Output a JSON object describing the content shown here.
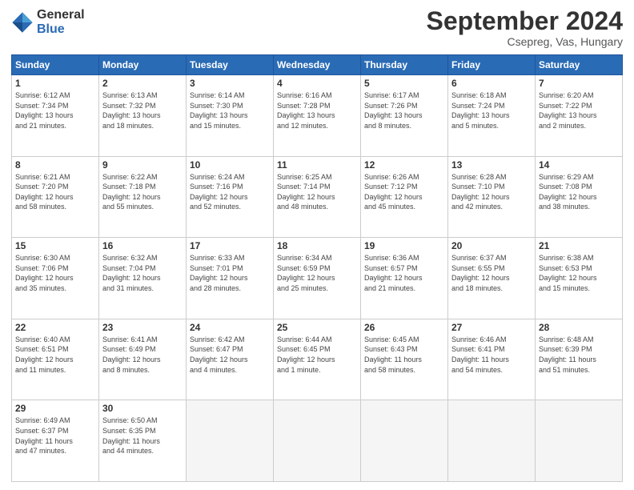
{
  "header": {
    "logo": {
      "general": "General",
      "blue": "Blue"
    },
    "title": "September 2024",
    "subtitle": "Csepreg, Vas, Hungary"
  },
  "weekdays": [
    "Sunday",
    "Monday",
    "Tuesday",
    "Wednesday",
    "Thursday",
    "Friday",
    "Saturday"
  ],
  "weeks": [
    [
      {
        "day": "1",
        "info": "Sunrise: 6:12 AM\nSunset: 7:34 PM\nDaylight: 13 hours\nand 21 minutes."
      },
      {
        "day": "2",
        "info": "Sunrise: 6:13 AM\nSunset: 7:32 PM\nDaylight: 13 hours\nand 18 minutes."
      },
      {
        "day": "3",
        "info": "Sunrise: 6:14 AM\nSunset: 7:30 PM\nDaylight: 13 hours\nand 15 minutes."
      },
      {
        "day": "4",
        "info": "Sunrise: 6:16 AM\nSunset: 7:28 PM\nDaylight: 13 hours\nand 12 minutes."
      },
      {
        "day": "5",
        "info": "Sunrise: 6:17 AM\nSunset: 7:26 PM\nDaylight: 13 hours\nand 8 minutes."
      },
      {
        "day": "6",
        "info": "Sunrise: 6:18 AM\nSunset: 7:24 PM\nDaylight: 13 hours\nand 5 minutes."
      },
      {
        "day": "7",
        "info": "Sunrise: 6:20 AM\nSunset: 7:22 PM\nDaylight: 13 hours\nand 2 minutes."
      }
    ],
    [
      {
        "day": "8",
        "info": "Sunrise: 6:21 AM\nSunset: 7:20 PM\nDaylight: 12 hours\nand 58 minutes."
      },
      {
        "day": "9",
        "info": "Sunrise: 6:22 AM\nSunset: 7:18 PM\nDaylight: 12 hours\nand 55 minutes."
      },
      {
        "day": "10",
        "info": "Sunrise: 6:24 AM\nSunset: 7:16 PM\nDaylight: 12 hours\nand 52 minutes."
      },
      {
        "day": "11",
        "info": "Sunrise: 6:25 AM\nSunset: 7:14 PM\nDaylight: 12 hours\nand 48 minutes."
      },
      {
        "day": "12",
        "info": "Sunrise: 6:26 AM\nSunset: 7:12 PM\nDaylight: 12 hours\nand 45 minutes."
      },
      {
        "day": "13",
        "info": "Sunrise: 6:28 AM\nSunset: 7:10 PM\nDaylight: 12 hours\nand 42 minutes."
      },
      {
        "day": "14",
        "info": "Sunrise: 6:29 AM\nSunset: 7:08 PM\nDaylight: 12 hours\nand 38 minutes."
      }
    ],
    [
      {
        "day": "15",
        "info": "Sunrise: 6:30 AM\nSunset: 7:06 PM\nDaylight: 12 hours\nand 35 minutes."
      },
      {
        "day": "16",
        "info": "Sunrise: 6:32 AM\nSunset: 7:04 PM\nDaylight: 12 hours\nand 31 minutes."
      },
      {
        "day": "17",
        "info": "Sunrise: 6:33 AM\nSunset: 7:01 PM\nDaylight: 12 hours\nand 28 minutes."
      },
      {
        "day": "18",
        "info": "Sunrise: 6:34 AM\nSunset: 6:59 PM\nDaylight: 12 hours\nand 25 minutes."
      },
      {
        "day": "19",
        "info": "Sunrise: 6:36 AM\nSunset: 6:57 PM\nDaylight: 12 hours\nand 21 minutes."
      },
      {
        "day": "20",
        "info": "Sunrise: 6:37 AM\nSunset: 6:55 PM\nDaylight: 12 hours\nand 18 minutes."
      },
      {
        "day": "21",
        "info": "Sunrise: 6:38 AM\nSunset: 6:53 PM\nDaylight: 12 hours\nand 15 minutes."
      }
    ],
    [
      {
        "day": "22",
        "info": "Sunrise: 6:40 AM\nSunset: 6:51 PM\nDaylight: 12 hours\nand 11 minutes."
      },
      {
        "day": "23",
        "info": "Sunrise: 6:41 AM\nSunset: 6:49 PM\nDaylight: 12 hours\nand 8 minutes."
      },
      {
        "day": "24",
        "info": "Sunrise: 6:42 AM\nSunset: 6:47 PM\nDaylight: 12 hours\nand 4 minutes."
      },
      {
        "day": "25",
        "info": "Sunrise: 6:44 AM\nSunset: 6:45 PM\nDaylight: 12 hours\nand 1 minute."
      },
      {
        "day": "26",
        "info": "Sunrise: 6:45 AM\nSunset: 6:43 PM\nDaylight: 11 hours\nand 58 minutes."
      },
      {
        "day": "27",
        "info": "Sunrise: 6:46 AM\nSunset: 6:41 PM\nDaylight: 11 hours\nand 54 minutes."
      },
      {
        "day": "28",
        "info": "Sunrise: 6:48 AM\nSunset: 6:39 PM\nDaylight: 11 hours\nand 51 minutes."
      }
    ],
    [
      {
        "day": "29",
        "info": "Sunrise: 6:49 AM\nSunset: 6:37 PM\nDaylight: 11 hours\nand 47 minutes."
      },
      {
        "day": "30",
        "info": "Sunrise: 6:50 AM\nSunset: 6:35 PM\nDaylight: 11 hours\nand 44 minutes."
      },
      {
        "day": "",
        "info": ""
      },
      {
        "day": "",
        "info": ""
      },
      {
        "day": "",
        "info": ""
      },
      {
        "day": "",
        "info": ""
      },
      {
        "day": "",
        "info": ""
      }
    ]
  ]
}
